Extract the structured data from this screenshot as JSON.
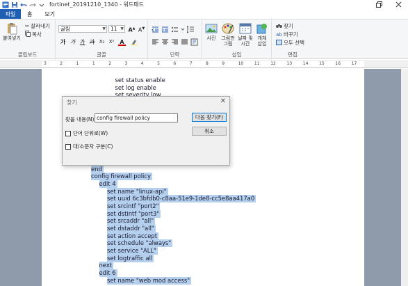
{
  "window": {
    "title": "fortinet_20191210_1340 - 워드패드",
    "restore_icon": "restore-icon",
    "close_icon": "close-icon"
  },
  "tabs": [
    {
      "label": "파일"
    },
    {
      "label": "홈"
    },
    {
      "label": "보기"
    }
  ],
  "ribbon": {
    "clipboard": {
      "paste": "붙여넣기",
      "cut": "잘라내기",
      "copy": "복사",
      "group": "클립보드"
    },
    "font": {
      "family": "굴림",
      "size": "11",
      "group": "글꼴"
    },
    "paragraph": {
      "group": "단락"
    },
    "insert": {
      "picture": "사진",
      "paint1": "그림판",
      "paint2": "그림",
      "datetime1": "날짜 및",
      "datetime2": "시간",
      "object1": "개체",
      "object2": "삽입",
      "group": "삽입"
    },
    "editing": {
      "find": "찾기",
      "replace": "바꾸기",
      "selectall": "모두 선택",
      "group": "편집"
    }
  },
  "ruler": {
    "labels": [
      "3",
      "2",
      "1",
      "1",
      "2",
      "3",
      "4",
      "5",
      "6",
      "7",
      "8",
      "9",
      "10",
      "11",
      "12",
      "13",
      "14",
      "15",
      "16",
      "17"
    ]
  },
  "document": {
    "lines": [
      {
        "text": "set status enable",
        "indent": 3,
        "highlight": false
      },
      {
        "text": "set log enable",
        "indent": 3,
        "highlight": false
      },
      {
        "text": "set severity low",
        "indent": 3,
        "highlight": false
      },
      {
        "text": "end",
        "indent": 0,
        "highlight": true
      },
      {
        "text": "config firewall policy",
        "indent": 0,
        "highlight": true
      },
      {
        "text": "edit 4",
        "indent": 1,
        "highlight": true
      },
      {
        "text": "set name \"linux-api\"",
        "indent": 2,
        "highlight": true
      },
      {
        "text": "set uuid 6c3bfdb0-c8aa-51e9-1de8-cc5e8aa417a0",
        "indent": 2,
        "highlight": true
      },
      {
        "text": "set srcintf \"port2\"",
        "indent": 2,
        "highlight": true
      },
      {
        "text": "set dstintf \"port3\"",
        "indent": 2,
        "highlight": true
      },
      {
        "text": "set srcaddr \"all\"",
        "indent": 2,
        "highlight": true
      },
      {
        "text": "set dstaddr \"all\"",
        "indent": 2,
        "highlight": true
      },
      {
        "text": "set action accept",
        "indent": 2,
        "highlight": true
      },
      {
        "text": "set schedule \"always\"",
        "indent": 2,
        "highlight": true
      },
      {
        "text": "set service \"ALL\"",
        "indent": 2,
        "highlight": true
      },
      {
        "text": "set logtraffic all",
        "indent": 2,
        "highlight": true
      },
      {
        "text": "next",
        "indent": 1,
        "highlight": true
      },
      {
        "text": "edit 6",
        "indent": 1,
        "highlight": true
      },
      {
        "text": "set name \"web mod access\"",
        "indent": 2,
        "highlight": true
      }
    ]
  },
  "find_dialog": {
    "title": "찾기",
    "find_label": "찾을 내용(N):",
    "find_value": "config firewall policy",
    "find_next": "다음 찾기(F)",
    "cancel": "취소",
    "whole_word": "단어 단위로(W)",
    "match_case": "대/소문자 구분(C)"
  }
}
